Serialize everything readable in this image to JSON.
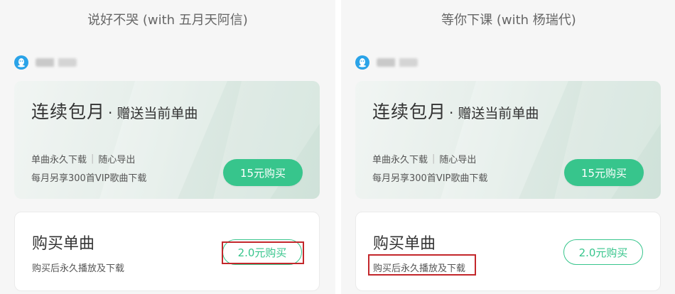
{
  "panels": [
    {
      "song_title": "说好不哭 (with 五月天阿信)",
      "monthly": {
        "title": "连续包月",
        "dot": "·",
        "subtitle": "赠送当前单曲",
        "benefit_a": "单曲永久下载",
        "benefit_sep": "|",
        "benefit_b": "随心导出",
        "benefit_line2": "每月另享300首VIP歌曲下载",
        "buy_label": "15元购买"
      },
      "single": {
        "title": "购买单曲",
        "desc": "购买后永久播放及下载",
        "buy_label": "2.0元购买"
      }
    },
    {
      "song_title": "等你下课 (with 杨瑞代)",
      "monthly": {
        "title": "连续包月",
        "dot": "·",
        "subtitle": "赠送当前单曲",
        "benefit_a": "单曲永久下载",
        "benefit_sep": "|",
        "benefit_b": "随心导出",
        "benefit_line2": "每月另享300首VIP歌曲下载",
        "buy_label": "15元购买"
      },
      "single": {
        "title": "购买单曲",
        "desc": "购买后永久播放及下载",
        "buy_label": "2.0元购买"
      }
    }
  ],
  "icons": {
    "account": "qq-penguin-icon"
  },
  "colors": {
    "accent": "#37c58c",
    "highlight_box": "#c3272b",
    "qq_blue": "#2aa3e8"
  }
}
